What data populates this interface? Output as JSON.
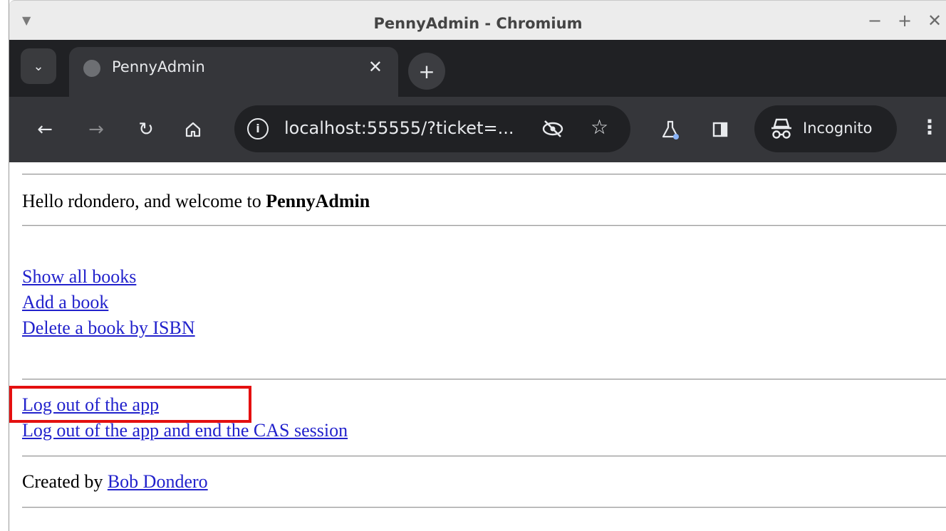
{
  "window": {
    "title": "PennyAdmin - Chromium",
    "menu_icon": "caret-down-icon",
    "controls": [
      "minimize-icon",
      "maximize-icon",
      "close-icon"
    ]
  },
  "tabs": {
    "dropdown_icon": "chevron-down-icon",
    "active_tab": {
      "title": "PennyAdmin",
      "favicon": "globe-icon",
      "close_icon": "close-icon"
    },
    "new_tab_icon": "plus-icon"
  },
  "toolbar": {
    "back_icon": "arrow-left-icon",
    "forward_icon": "arrow-right-icon",
    "reload_icon": "reload-icon",
    "home_icon": "home-icon",
    "url": "localhost:55555/?ticket=...",
    "info_icon": "info-icon",
    "tracking_icon": "eye-off-icon",
    "bookmark_icon": "star-icon",
    "labs_icon": "flask-icon",
    "sidepanel_icon": "side-panel-icon",
    "incognito_label": "Incognito",
    "incognito_icon": "incognito-icon",
    "menu_icon": "kebab-menu-icon"
  },
  "page": {
    "greeting_prefix": "Hello rdondero, and welcome to ",
    "app_name": "PennyAdmin",
    "links": {
      "show_all_books": "Show all books",
      "add_book": "Add a book",
      "delete_book": "Delete a book by ISBN",
      "logout_app": "Log out of the app",
      "logout_cas": "Log out of the app and end the CAS session"
    },
    "footer_prefix": "Created by ",
    "author": "Bob Dondero"
  },
  "colors": {
    "link": "#2222cc",
    "highlight": "#e41010",
    "toolbar_bg": "#35363a",
    "tabstrip_bg": "#202124"
  }
}
